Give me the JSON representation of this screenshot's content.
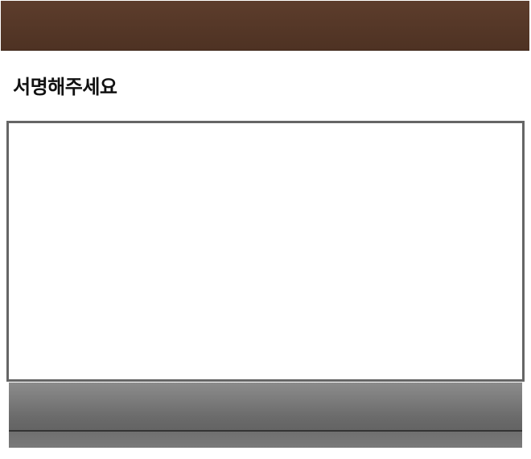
{
  "header": {
    "title": "서명해주세요"
  },
  "colors": {
    "top_bar": "#5d3d2c",
    "pad_border": "#666666",
    "action_bar": "#6a6a6a"
  }
}
